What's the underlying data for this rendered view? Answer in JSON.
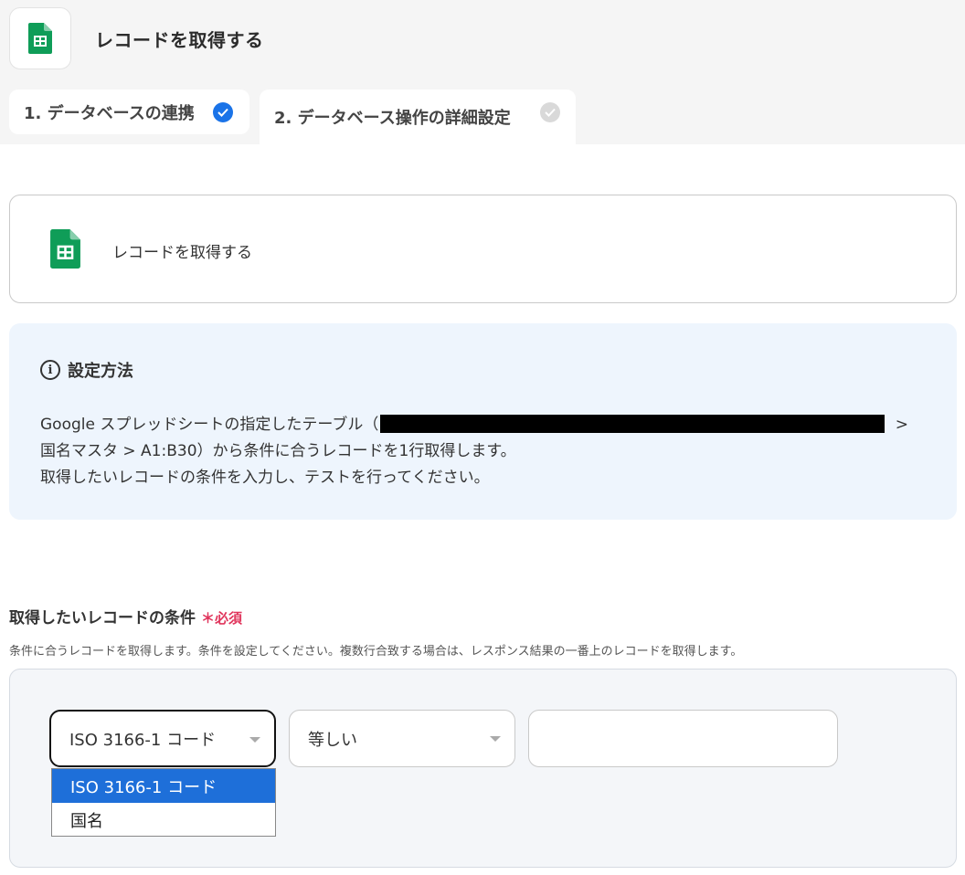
{
  "header": {
    "title": "レコードを取得する",
    "app_icon": "google-sheets-icon"
  },
  "tabs": [
    {
      "label": "1. データベースの連携",
      "status": "complete"
    },
    {
      "label": "2. データベース操作の詳細設定",
      "status": "incomplete"
    }
  ],
  "action_card": {
    "label": "レコードを取得する",
    "icon": "google-sheets-icon"
  },
  "info": {
    "heading": "設定方法",
    "line1_prefix": "Google スプレッドシートの指定したテーブル（",
    "line1_suffix": " >",
    "line2": "国名マスタ > A1:B30）から条件に合うレコードを1行取得します。",
    "line3": "取得したいレコードの条件を入力し、テストを行ってください。"
  },
  "condition": {
    "title": "取得したいレコードの条件",
    "required_mark": "＊",
    "required_label": "必須",
    "description": "条件に合うレコードを取得します。条件を設定してください。複数行合致する場合は、レスポンス結果の一番上のレコードを取得します。",
    "field_select": {
      "value": "ISO 3166-1 コード",
      "options": [
        "ISO 3166-1 コード",
        "国名"
      ]
    },
    "operator_select": {
      "value": "等しい"
    },
    "value_input": {
      "value": ""
    }
  },
  "colors": {
    "accent": "#1a73e8",
    "required": "#e0355c",
    "sheets_green": "#0f9d58",
    "dropdown_highlight": "#1e6fd9"
  }
}
